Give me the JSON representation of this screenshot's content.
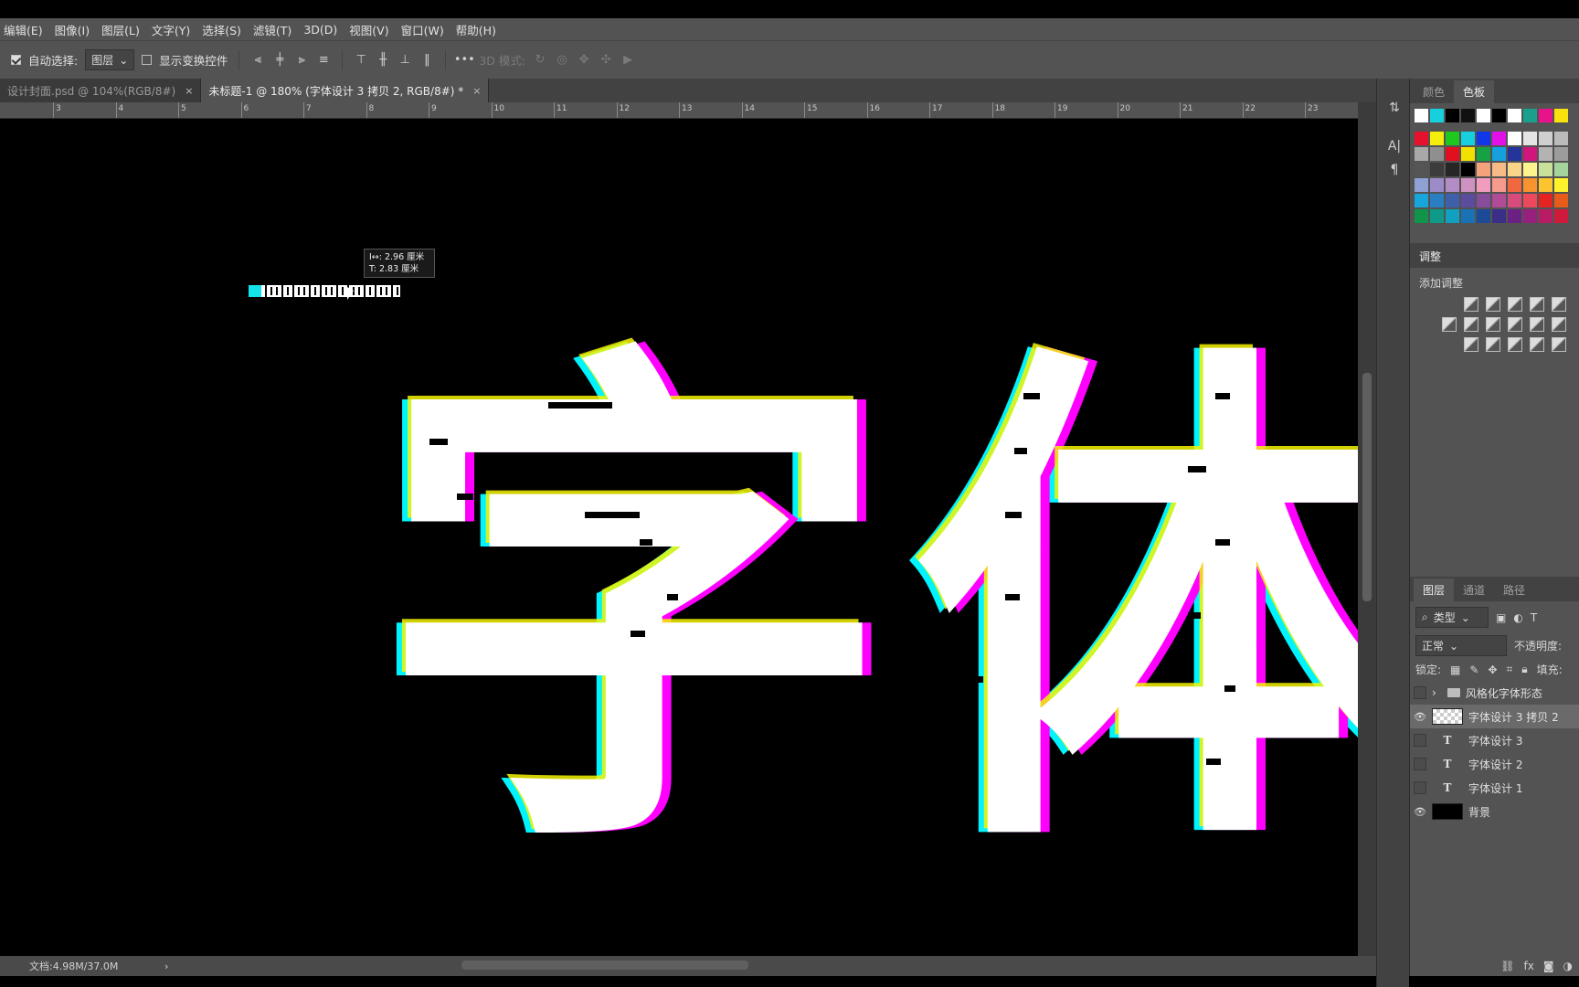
{
  "menu": [
    "编辑(E)",
    "图像(I)",
    "图层(L)",
    "文字(Y)",
    "选择(S)",
    "滤镜(T)",
    "3D(D)",
    "视图(V)",
    "窗口(W)",
    "帮助(H)"
  ],
  "options": {
    "auto_select_label": "自动选择:",
    "auto_select_value": "图层",
    "show_transform_label": "显示变换控件",
    "mode3d_label": "3D 模式:",
    "more": "•••"
  },
  "tabs": [
    {
      "label": "设计封面.psd @ 104%(RGB/8#)",
      "close": "×"
    },
    {
      "label": "未标题-1 @ 180% (字体设计 3 拷贝 2, RGB/8#) *",
      "close": "×"
    }
  ],
  "ruler": {
    "numbers": [
      "3",
      "4",
      "5",
      "6",
      "7",
      "8",
      "9",
      "10",
      "11",
      "12",
      "13",
      "14",
      "15",
      "16",
      "17",
      "18",
      "19",
      "20",
      "21",
      "22",
      "23"
    ]
  },
  "tooltip": {
    "line1": "I↔: 2.96 厘米",
    "line2": "T: 2.83 厘米"
  },
  "canvas_text": {
    "char1": "字",
    "char2": "体"
  },
  "status": {
    "doc": "文档:4.98M/37.0M",
    "arrow": "›"
  },
  "panels": {
    "swatch_tabs": [
      "颜色",
      "色板"
    ],
    "adjust_title": "调整",
    "adjust_sub": "添加调整",
    "layer_tabs": [
      "图层",
      "通道",
      "路径"
    ],
    "filter_label": "类型",
    "blend_mode": "正常",
    "opacity_label": "不透明度:",
    "lock_label": "锁定:",
    "fill_label": "填充:",
    "layers": [
      {
        "name": "风格化字体形态",
        "kind": "folder",
        "visible": false
      },
      {
        "name": "字体设计 3 拷贝 2",
        "kind": "pixel",
        "visible": true,
        "selected": true
      },
      {
        "name": "字体设计 3",
        "kind": "text",
        "visible": false
      },
      {
        "name": "字体设计 2",
        "kind": "text",
        "visible": false
      },
      {
        "name": "字体设计 1",
        "kind": "text",
        "visible": false
      },
      {
        "name": "背景",
        "kind": "background",
        "visible": true
      }
    ],
    "footer_icons": [
      "link-icon",
      "fx",
      "mask-icon",
      "adjust-icon"
    ]
  },
  "swatch_colors": {
    "top": [
      "#ffffff",
      "#16d0de",
      "#000000",
      "#111111",
      "#ffffff",
      "#000000",
      "#ffffff",
      "#1ba08b",
      "#e8128a",
      "#f7e20e"
    ],
    "rows": [
      [
        "#e8112d",
        "#f5ed0b",
        "#1ec81e",
        "#16d0de",
        "#1038e8",
        "#e311e8",
        "#ffffff",
        "#e4e4e4",
        "#cfcfcf",
        "#bbbbbb"
      ],
      [
        "#a8a8a8",
        "#8f8f8f",
        "#e0101f",
        "#f2e100",
        "#16a243",
        "#15a0de",
        "#25349b",
        "#d0167c",
        "#b3b3b3",
        "#9c9c9c"
      ],
      [
        "#555555",
        "#3c3c3c",
        "#262626",
        "#000000",
        "#f4a27a",
        "#f6bb86",
        "#f9d58a",
        "#fdf48e",
        "#c9e29b",
        "#a2d49c"
      ],
      [
        "#8fa0d4",
        "#9b8bc8",
        "#b38cc6",
        "#cf91c2",
        "#f29cbd",
        "#f59a8d",
        "#f1683e",
        "#f7942e",
        "#fbc52f",
        "#fff22b"
      ],
      [
        "#17a6d9",
        "#2a7fc3",
        "#3e5fa9",
        "#5b4c9d",
        "#874c9b",
        "#b24b95",
        "#d74c7d",
        "#ec4a5c",
        "#e52421",
        "#e65c1a"
      ],
      [
        "#10944a",
        "#0e9a86",
        "#10a1c1",
        "#1971b6",
        "#1c4a96",
        "#3a2e86",
        "#6b2184",
        "#96207b",
        "#b91c64",
        "#d01a3b"
      ]
    ]
  }
}
